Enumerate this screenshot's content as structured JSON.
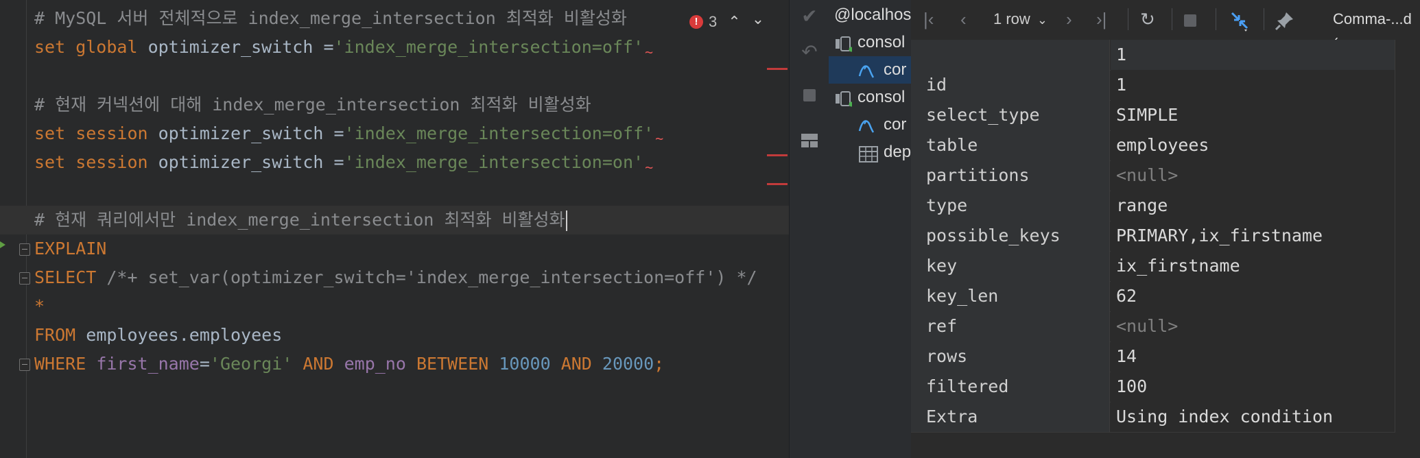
{
  "editor": {
    "inspection": {
      "error_count": "3"
    },
    "lines": [
      {
        "tokens": [
          {
            "t": "# MySQL 서버 전체적으로 index_merge_intersection 최적화 비활성화",
            "c": "cmt"
          }
        ]
      },
      {
        "tokens": [
          {
            "t": "set global",
            "c": "kw"
          },
          {
            "t": " optimizer_switch =",
            "c": "plain"
          },
          {
            "t": "'index_merge_intersection=off'",
            "c": "str"
          }
        ],
        "squiggle": true
      },
      {
        "tokens": []
      },
      {
        "tokens": [
          {
            "t": "# 현재 커넥션에 대해 index_merge_intersection 최적화 비활성화",
            "c": "cmt"
          }
        ]
      },
      {
        "tokens": [
          {
            "t": "set session",
            "c": "kw"
          },
          {
            "t": " optimizer_switch =",
            "c": "plain"
          },
          {
            "t": "'index_merge_intersection=off'",
            "c": "str"
          }
        ],
        "squiggle": true
      },
      {
        "tokens": [
          {
            "t": "set session",
            "c": "kw"
          },
          {
            "t": " optimizer_switch =",
            "c": "plain"
          },
          {
            "t": "'index_merge_intersection=on'",
            "c": "str"
          }
        ],
        "squiggle": true
      },
      {
        "tokens": []
      },
      {
        "tokens": [
          {
            "t": "# 현재 쿼리에서만 index_merge_intersection 최적화 비활성화",
            "c": "cmt"
          }
        ],
        "caret": true,
        "current": true
      },
      {
        "tokens": [
          {
            "t": "EXPLAIN",
            "c": "kw"
          }
        ],
        "fold": true
      },
      {
        "tokens": [
          {
            "t": "SELECT",
            "c": "kw"
          },
          {
            "t": " /*+ set_var(optimizer_switch='index_merge_intersection=off') */",
            "c": "cmt"
          }
        ],
        "fold": true
      },
      {
        "tokens": [
          {
            "t": "*",
            "c": "kw"
          }
        ]
      },
      {
        "tokens": [
          {
            "t": "FROM",
            "c": "kw"
          },
          {
            "t": " employees.employees",
            "c": "plain"
          }
        ]
      },
      {
        "tokens": [
          {
            "t": "WHERE",
            "c": "kw"
          },
          {
            "t": " ",
            "c": "plain"
          },
          {
            "t": "first_name",
            "c": "fld"
          },
          {
            "t": "=",
            "c": "plain"
          },
          {
            "t": "'Georgi'",
            "c": "str"
          },
          {
            "t": " AND ",
            "c": "kw"
          },
          {
            "t": "emp_no",
            "c": "fld"
          },
          {
            "t": " BETWEEN ",
            "c": "kw"
          },
          {
            "t": "10000",
            "c": "num"
          },
          {
            "t": " AND ",
            "c": "kw"
          },
          {
            "t": "20000",
            "c": "num"
          },
          {
            "t": ";",
            "c": "kw"
          }
        ],
        "fold": true
      }
    ]
  },
  "toolbar": {
    "commit_icon": "check-icon",
    "rollback_icon": "undo-icon",
    "stop_icon": "stop-icon",
    "layout_icon": "layout-icon"
  },
  "tree": {
    "items": [
      {
        "label": "@localhos",
        "icon": ""
      },
      {
        "label": "consol",
        "icon": "console-icon"
      },
      {
        "label": "cor",
        "icon": "mysql-icon"
      },
      {
        "label": "consol",
        "icon": "console-icon"
      },
      {
        "label": "cor",
        "icon": "mysql-icon"
      },
      {
        "label": "dep",
        "icon": "table-icon"
      }
    ]
  },
  "results": {
    "toolbar": {
      "rows_label": "1 row",
      "tab_label": "Comma-...d ("
    },
    "header_value": "1",
    "rows": [
      {
        "name": "id",
        "value": "1"
      },
      {
        "name": "select_type",
        "value": "SIMPLE"
      },
      {
        "name": "table",
        "value": "employees"
      },
      {
        "name": "partitions",
        "value": "<null>",
        "null": true
      },
      {
        "name": "type",
        "value": "range"
      },
      {
        "name": "possible_keys",
        "value": "PRIMARY,ix_firstname"
      },
      {
        "name": "key",
        "value": "ix_firstname"
      },
      {
        "name": "key_len",
        "value": "62"
      },
      {
        "name": "ref",
        "value": "<null>",
        "null": true
      },
      {
        "name": "rows",
        "value": "14"
      },
      {
        "name": "filtered",
        "value": "100"
      },
      {
        "name": "Extra",
        "value": "Using index condition"
      }
    ]
  }
}
